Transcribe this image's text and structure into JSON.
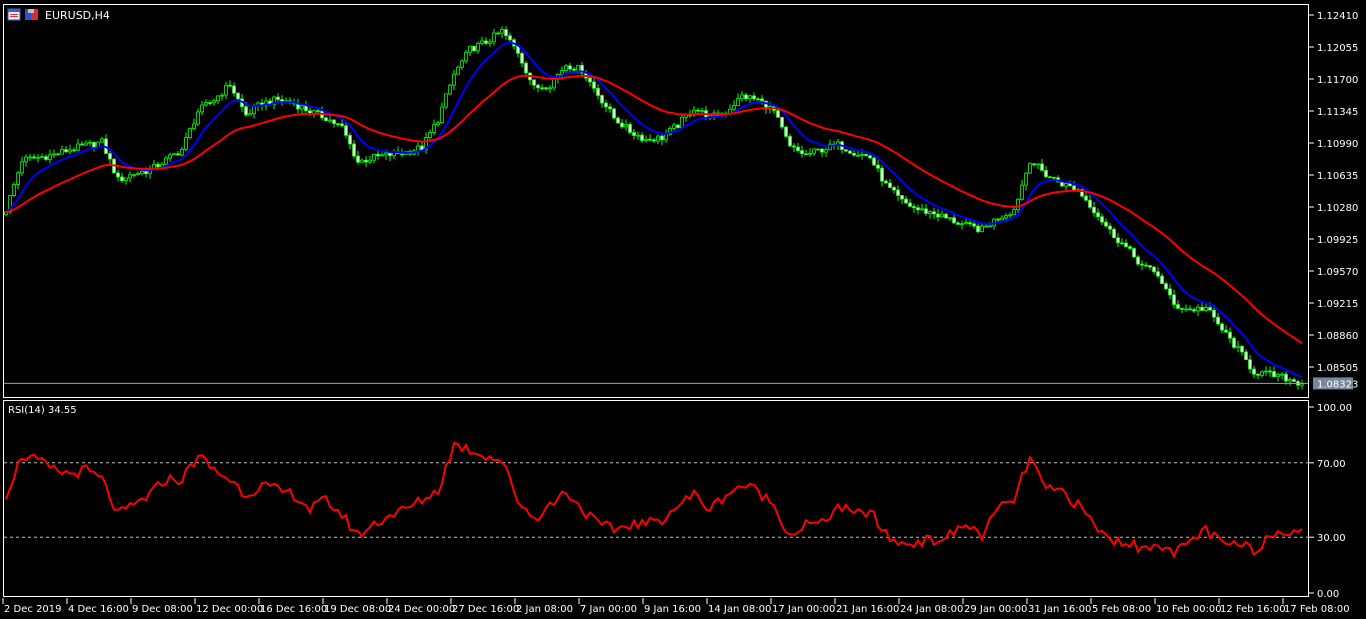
{
  "window": {
    "symbol_title": "EURUSD,H4",
    "icons": [
      "chart-window-icon",
      "save-icon"
    ]
  },
  "colors": {
    "bull_outline": "#00ff00",
    "bear_fill": "#ffffff",
    "ma_fast": "#0000ff",
    "ma_slow": "#ff0000",
    "rsi": "#ff0000",
    "grid": "#c0c0c0",
    "price_badge": "#778899"
  },
  "chart_data": [
    {
      "type": "candlestick",
      "title": "EURUSD,H4",
      "timeframe": "H4",
      "bars_per_keypoint": 4,
      "ylim": [
        1.0815,
        1.1245
      ],
      "price_ticks": [
        "1.12410",
        "1.12055",
        "1.11700",
        "1.11345",
        "1.10990",
        "1.10635",
        "1.10280",
        "1.09925",
        "1.09570",
        "1.09215",
        "1.08860",
        "1.08505"
      ],
      "current_price": "1.08323",
      "close_keypoints": [
        1.1025,
        1.108,
        1.1083,
        1.1086,
        1.1092,
        1.1096,
        1.11,
        1.1058,
        1.1065,
        1.1069,
        1.108,
        1.1092,
        1.1134,
        1.1147,
        1.1164,
        1.113,
        1.1143,
        1.1147,
        1.1143,
        1.1134,
        1.1127,
        1.1116,
        1.1078,
        1.1083,
        1.1086,
        1.1089,
        1.1094,
        1.1125,
        1.1175,
        1.1203,
        1.1211,
        1.1223,
        1.12,
        1.116,
        1.1164,
        1.1186,
        1.118,
        1.1153,
        1.1127,
        1.1112,
        1.1103,
        1.1105,
        1.1119,
        1.1138,
        1.1127,
        1.1134,
        1.1151,
        1.1147,
        1.1134,
        1.1094,
        1.1086,
        1.1092,
        1.1097,
        1.1089,
        1.1083,
        1.1052,
        1.1034,
        1.1025,
        1.1021,
        1.1014,
        1.1007,
        1.1003,
        1.1016,
        1.1025,
        1.108,
        1.1064,
        1.1054,
        1.1047,
        1.1025,
        1.1001,
        1.0983,
        1.0963,
        1.0953,
        1.0919,
        1.0914,
        1.0916,
        1.0892,
        1.087,
        1.0845,
        1.0842,
        1.0838,
        1.0832
      ],
      "series": [
        {
          "name": "MA fast",
          "color": "blue"
        },
        {
          "name": "MA slow",
          "color": "red"
        }
      ]
    },
    {
      "type": "line",
      "title": "RSI(14) 34.55",
      "ylim": [
        0,
        100
      ],
      "levels": [
        70,
        30
      ],
      "tick_labels": [
        "100.00",
        "70.00",
        "30.00",
        "0.00"
      ],
      "values_keypoints": [
        53,
        74,
        71,
        66,
        64,
        66,
        61,
        42,
        47,
        53,
        61,
        61,
        74,
        66,
        61,
        53,
        58,
        55,
        53,
        45,
        50,
        42,
        31,
        37,
        42,
        45,
        50,
        55,
        80,
        77,
        74,
        71,
        50,
        40,
        47,
        55,
        45,
        37,
        34,
        37,
        37,
        40,
        47,
        53,
        45,
        53,
        58,
        55,
        47,
        31,
        37,
        37,
        47,
        42,
        44,
        31,
        26,
        28,
        28,
        31,
        37,
        31,
        45,
        50,
        73,
        55,
        55,
        47,
        37,
        28,
        28,
        23,
        28,
        20,
        28,
        34,
        26,
        26,
        23,
        31,
        34,
        34.55
      ]
    }
  ],
  "time_axis": [
    "2 Dec 2019",
    "4 Dec 16:00",
    "9 Dec 08:00",
    "12 Dec 00:00",
    "16 Dec 16:00",
    "19 Dec 08:00",
    "24 Dec 00:00",
    "27 Dec 16:00",
    "2 Jan 08:00",
    "7 Jan 00:00",
    "9 Jan 16:00",
    "14 Jan 08:00",
    "17 Jan 00:00",
    "21 Jan 16:00",
    "24 Jan 08:00",
    "29 Jan 00:00",
    "31 Jan 16:00",
    "5 Feb 08:00",
    "10 Feb 00:00",
    "12 Feb 16:00",
    "17 Feb 08:00"
  ]
}
